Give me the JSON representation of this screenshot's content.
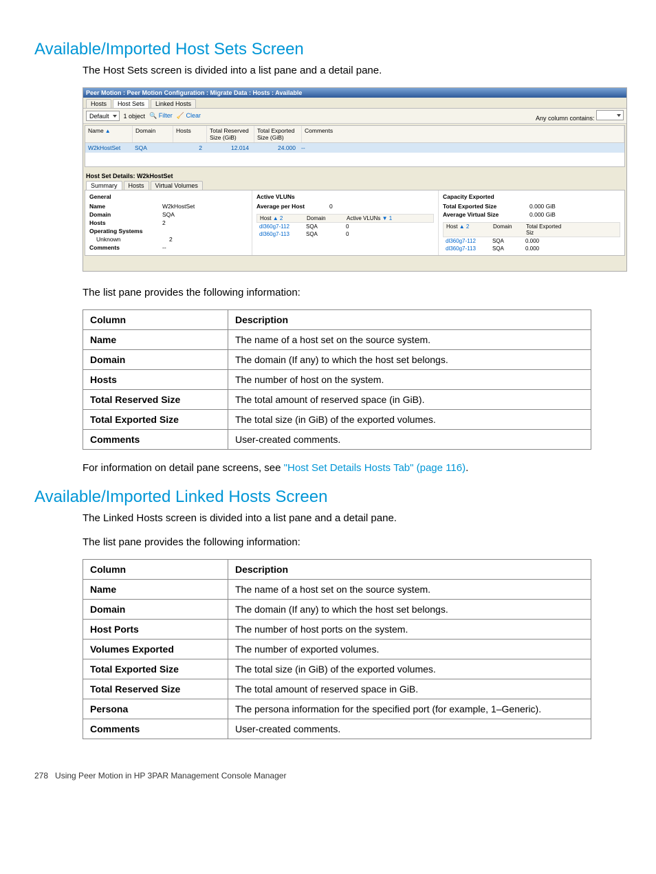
{
  "sections": {
    "s1": {
      "title": "Available/Imported Host Sets Screen",
      "intro": "The Host Sets screen is divided into a list pane and a detail pane.",
      "after_list_intro": "The list pane provides the following information:",
      "link_sentence_prefix": "For information on detail pane screens, see ",
      "link_text": "\"Host Set Details Hosts Tab\" (page 116)",
      "link_sentence_suffix": "."
    },
    "s2": {
      "title": "Available/Imported Linked Hosts Screen",
      "intro1": "The Linked Hosts screen is divided into a list pane and a detail pane.",
      "intro2": "The list pane provides the following information:"
    }
  },
  "app": {
    "titlebar": "Peer Motion : Peer Motion Configuration : Migrate Data : Hosts : Available",
    "upper_tabs": [
      "Hosts",
      "Host Sets",
      "Linked Hosts"
    ],
    "toolbar": {
      "dropdown_value": "Default",
      "objects_text": "1 object",
      "filter": "Filter",
      "clear": "Clear",
      "any_column": "Any column contains:"
    },
    "list_headers": {
      "name": "Name",
      "domain": "Domain",
      "hosts": "Hosts",
      "total_reserved": "Total\nReserved Size\n(GiB)",
      "total_exported": "Total\nExported Size\n(GiB)",
      "comments": "Comments"
    },
    "list_row": {
      "name": "W2kHostSet",
      "domain": "SQA",
      "hosts": "2",
      "reserved": "12.014",
      "exported": "24.000",
      "comments": "--"
    },
    "detail_title": "Host Set Details: W2kHostSet",
    "detail_tabs": [
      "Summary",
      "Hosts",
      "Virtual Volumes"
    ],
    "general": {
      "title": "General",
      "rows": [
        {
          "k": "Name",
          "v": "W2kHostSet",
          "bold": true
        },
        {
          "k": "Domain",
          "v": "SQA",
          "bold": true
        },
        {
          "k": "Hosts",
          "v": "2",
          "bold": true
        },
        {
          "k": "Operating Systems",
          "v": "",
          "bold": true
        },
        {
          "k": "Unknown",
          "v": "2",
          "bold": false
        },
        {
          "k": "Comments",
          "v": "--",
          "bold": true
        }
      ]
    },
    "active_vluns": {
      "title": "Active VLUNs",
      "avg_label": "Average per Host",
      "avg_value": "0",
      "headers": [
        "Host",
        "Domain",
        "Active VLUNs"
      ],
      "sort1": "▲ 2",
      "sort2": "▼ 1",
      "rows": [
        {
          "host": "dl360g7-112",
          "domain": "SQA",
          "vluns": "0"
        },
        {
          "host": "dl360g7-113",
          "domain": "SQA",
          "vluns": "0"
        }
      ]
    },
    "capacity": {
      "title": "Capacity Exported",
      "total_exported_label": "Total Exported Size",
      "total_exported_value": "0.000 GiB",
      "avg_virtual_label": "Average Virtual Size",
      "avg_virtual_value": "0.000 GiB",
      "headers": [
        "Host",
        "Domain",
        "Total Exported Siz"
      ],
      "sort1": "▲ 2",
      "rows": [
        {
          "host": "dl360g7-112",
          "domain": "SQA",
          "size": "0.000"
        },
        {
          "host": "dl360g7-113",
          "domain": "SQA",
          "size": "0.000"
        }
      ]
    }
  },
  "table1": {
    "headers": [
      "Column",
      "Description"
    ],
    "rows": [
      [
        "Name",
        "The name of a host set on the source system."
      ],
      [
        "Domain",
        "The domain (If any) to which the host set belongs."
      ],
      [
        "Hosts",
        "The number of host on the system."
      ],
      [
        "Total Reserved Size",
        "The total amount of reserved space (in GiB)."
      ],
      [
        "Total Exported Size",
        "The total size (in GiB) of the exported volumes."
      ],
      [
        "Comments",
        "User-created comments."
      ]
    ]
  },
  "table2": {
    "headers": [
      "Column",
      "Description"
    ],
    "rows": [
      [
        "Name",
        "The name of a host set on the source system."
      ],
      [
        "Domain",
        "The domain (If any) to which the host set belongs."
      ],
      [
        "Host Ports",
        "The number of host ports on the system."
      ],
      [
        "Volumes Exported",
        "The number of exported volumes."
      ],
      [
        "Total Exported Size",
        "The total size (in GiB) of the exported volumes."
      ],
      [
        "Total Reserved Size",
        "The total amount of reserved space in GiB."
      ],
      [
        "Persona",
        "The persona information for the specified port (for example, 1–Generic)."
      ],
      [
        "Comments",
        "User-created comments."
      ]
    ]
  },
  "footer": {
    "page_number": "278",
    "text": "Using Peer Motion in HP 3PAR Management Console Manager"
  }
}
